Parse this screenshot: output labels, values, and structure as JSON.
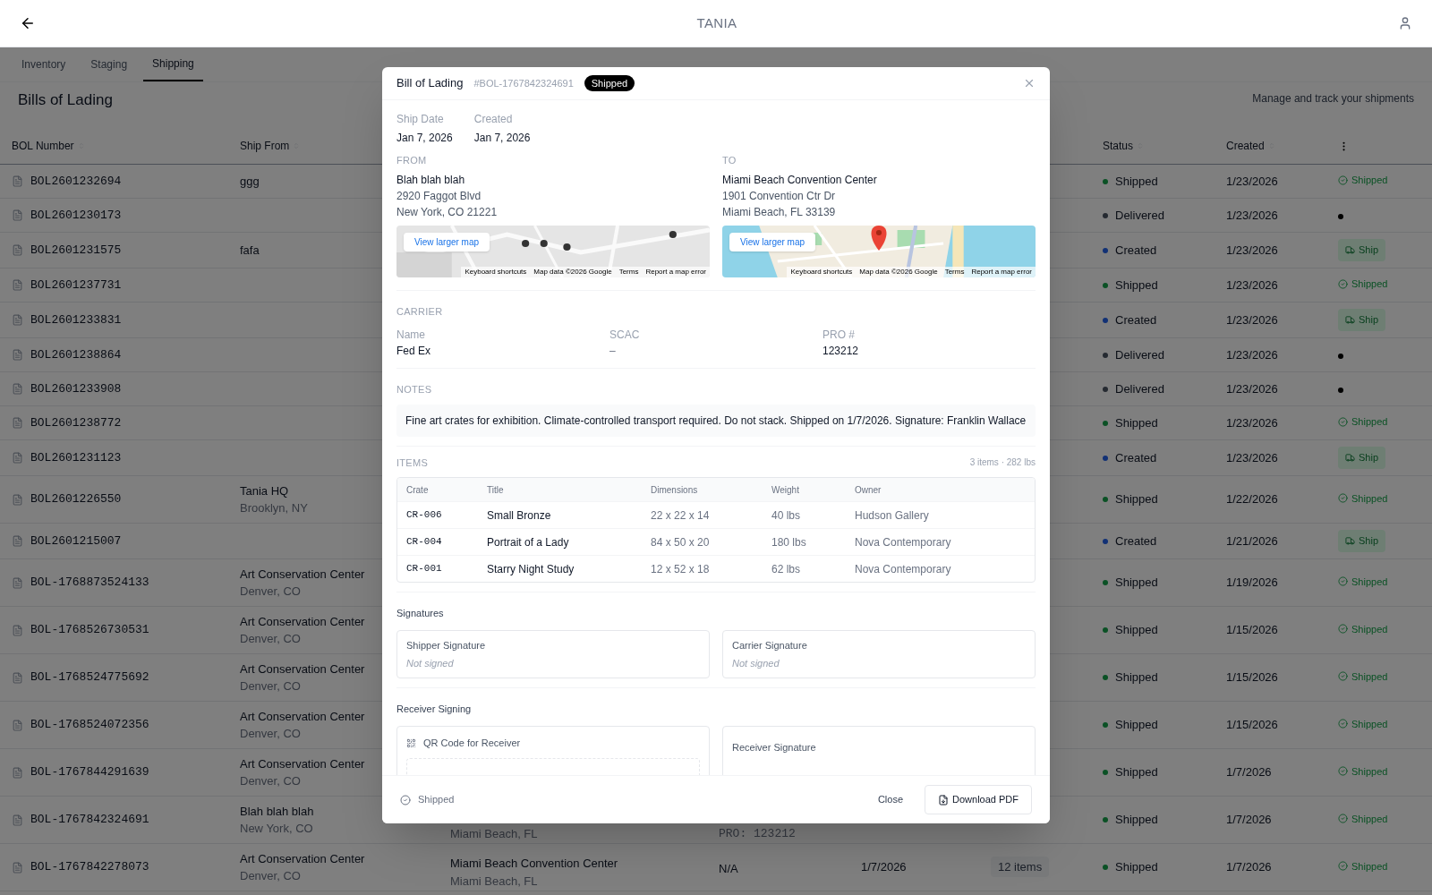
{
  "header": {
    "title": "TANIA"
  },
  "tabs": [
    {
      "label": "Inventory",
      "selected": false
    },
    {
      "label": "Staging",
      "selected": false
    },
    {
      "label": "Shipping",
      "selected": true
    }
  ],
  "page": {
    "title": "Bills of Lading",
    "subtitle": "Manage and track your shipments"
  },
  "table": {
    "columns": [
      "BOL Number",
      "Ship From",
      "Status",
      "Created"
    ],
    "rows": [
      {
        "bol": "BOL2601232694",
        "from_name": "ggg",
        "status": "Shipped",
        "color": "#0b5125",
        "created": "1/23/2026",
        "action": {
          "kind": "shipped",
          "label": "Shipped"
        }
      },
      {
        "bol": "BOL2601230173",
        "status": "Delivered",
        "color": "#252a31",
        "created": "1/23/2026",
        "action": {
          "kind": "dot"
        }
      },
      {
        "bol": "BOL2601231575",
        "from_name": "fafa",
        "status": "Created",
        "color": "#123175",
        "created": "1/23/2026",
        "action": {
          "kind": "ship",
          "label": "Ship"
        }
      },
      {
        "bol": "BOL2601237731",
        "status": "Shipped",
        "color": "#0b5125",
        "created": "1/23/2026",
        "action": {
          "kind": "shipped",
          "label": "Shipped"
        }
      },
      {
        "bol": "BOL2601233831",
        "status": "Created",
        "color": "#123175",
        "created": "1/23/2026",
        "action": {
          "kind": "ship",
          "label": "Ship"
        }
      },
      {
        "bol": "BOL2601238864",
        "status": "Delivered",
        "color": "#252a31",
        "created": "1/23/2026",
        "action": {
          "kind": "dot"
        }
      },
      {
        "bol": "BOL2601233908",
        "status": "Delivered",
        "color": "#252a31",
        "created": "1/23/2026",
        "action": {
          "kind": "dot"
        }
      },
      {
        "bol": "BOL2601238772",
        "status": "Shipped",
        "color": "#0b5125",
        "created": "1/23/2026",
        "action": {
          "kind": "shipped",
          "label": "Shipped"
        }
      },
      {
        "bol": "BOL2601231123",
        "status": "Created",
        "color": "#123175",
        "created": "1/23/2026",
        "action": {
          "kind": "ship",
          "label": "Ship"
        }
      },
      {
        "bol": "BOL2601226550",
        "from_name": "Tania HQ",
        "from_city": "Brooklyn, NY",
        "status": "Shipped",
        "color": "#0b5125",
        "created": "1/22/2026",
        "action": {
          "kind": "shipped",
          "label": "Shipped"
        }
      },
      {
        "bol": "BOL2601215007",
        "status": "Created",
        "color": "#123175",
        "created": "1/21/2026",
        "action": {
          "kind": "ship",
          "label": "Ship"
        }
      },
      {
        "bol": "BOL-1768873524133",
        "from_name": "Art Conservation Center",
        "from_city": "Denver, CO",
        "status": "Shipped",
        "color": "#0b5125",
        "created": "1/19/2026",
        "action": {
          "kind": "shipped",
          "label": "Shipped"
        }
      },
      {
        "bol": "BOL-1768526730531",
        "from_name": "Art Conservation Center",
        "from_city": "Denver, CO",
        "status": "Shipped",
        "color": "#0b5125",
        "created": "1/15/2026",
        "action": {
          "kind": "shipped",
          "label": "Shipped"
        }
      },
      {
        "bol": "BOL-1768524775692",
        "from_name": "Art Conservation Center",
        "from_city": "Denver, CO",
        "status": "Shipped",
        "color": "#0b5125",
        "created": "1/15/2026",
        "action": {
          "kind": "shipped",
          "label": "Shipped"
        }
      },
      {
        "bol": "BOL-1768524072356",
        "from_name": "Art Conservation Center",
        "from_city": "Denver, CO",
        "status": "Shipped",
        "color": "#0b5125",
        "created": "1/15/2026",
        "action": {
          "kind": "shipped",
          "label": "Shipped"
        }
      },
      {
        "bol": "BOL-1767844291639",
        "from_name": "Art Conservation Center",
        "from_city": "Denver, CO",
        "status": "Shipped",
        "color": "#0b5125",
        "created": "1/7/2026",
        "action": {
          "kind": "shipped",
          "label": "Shipped"
        }
      },
      {
        "bol": "BOL-1767842324691",
        "from_name": "Blah blah blah",
        "from_city": "New York, CO",
        "to_city": "Miami Beach, FL",
        "carrier_line2": "PRO: 123212",
        "status": "Shipped",
        "color": "#0b5125",
        "created": "1/7/2026",
        "action": {
          "kind": "shipped",
          "label": "Shipped"
        }
      },
      {
        "bol": "BOL-1767842278073",
        "from_name": "Art Conservation Center",
        "from_city": "Denver, CO",
        "to_name": "Miami Beach Convention Center",
        "to_city": "Miami Beach, FL",
        "carrier": "N/A",
        "ship_date": "1/7/2026",
        "items": "12 items",
        "status": "Shipped",
        "color": "#0b5125",
        "created": "1/7/2026",
        "action": {
          "kind": "shipped",
          "label": "Shipped"
        }
      }
    ]
  },
  "modal": {
    "title": "Bill of Lading",
    "number": "#BOL-1767842324691",
    "badge": "Shipped",
    "dates": [
      {
        "label": "Ship Date",
        "value": "Jan 7, 2026"
      },
      {
        "label": "Created",
        "value": "Jan 7, 2026"
      }
    ],
    "addresses": [
      {
        "heading": "FROM",
        "name": "Blah blah blah",
        "lines": [
          "2920 Faggot Blvd",
          "New York, CO 21221"
        ],
        "map": {
          "button": "View larger map",
          "attribution": [
            "Keyboard shortcuts",
            "Map data ©2026 Google",
            "Terms",
            "Report a map error"
          ]
        }
      },
      {
        "heading": "TO",
        "name": "Miami Beach Convention Center",
        "lines": [
          "1901 Convention Ctr Dr",
          "Miami Beach, FL 33139"
        ],
        "map": {
          "button": "View larger map",
          "attribution": [
            "Keyboard shortcuts",
            "Map data ©2026 Google",
            "Terms",
            "Report a map error"
          ]
        }
      }
    ],
    "carrier": {
      "heading": "CARRIER",
      "fields": [
        {
          "label": "Name",
          "value": "Fed Ex",
          "empty": false
        },
        {
          "label": "SCAC",
          "value": "–",
          "empty": true
        },
        {
          "label": "PRO #",
          "value": "123212",
          "empty": false
        }
      ]
    },
    "notes": {
      "heading": "NOTES",
      "text": "Fine art crates for exhibition. Climate-controlled transport required. Do not stack. Shipped on 1/7/2026. Signature: Franklin Wallace"
    },
    "items": {
      "heading": "ITEMS",
      "summary": "3 items · 282 lbs",
      "columns": [
        "Crate",
        "Title",
        "Dimensions",
        "Weight",
        "Owner"
      ],
      "rows": [
        [
          "CR-006",
          "Small Bronze",
          "22 x 22 x 14",
          "40 lbs",
          "Hudson Gallery"
        ],
        [
          "CR-004",
          "Portrait of a Lady",
          "84 x 50 x 20",
          "180 lbs",
          "Nova Contemporary"
        ],
        [
          "CR-001",
          "Starry Night Study",
          "12 x 52 x 18",
          "62 lbs",
          "Nova Contemporary"
        ]
      ]
    },
    "signatures": {
      "heading": "Signatures",
      "cards": [
        {
          "label": "Shipper Signature",
          "value": "Not signed"
        },
        {
          "label": "Carrier Signature",
          "value": "Not signed"
        }
      ]
    },
    "receiver": {
      "heading": "Receiver Signing",
      "qr_label": "QR Code for Receiver",
      "signature_label": "Receiver Signature"
    },
    "footer": {
      "status": "Shipped",
      "close": "Close",
      "download": "Download PDF"
    }
  }
}
